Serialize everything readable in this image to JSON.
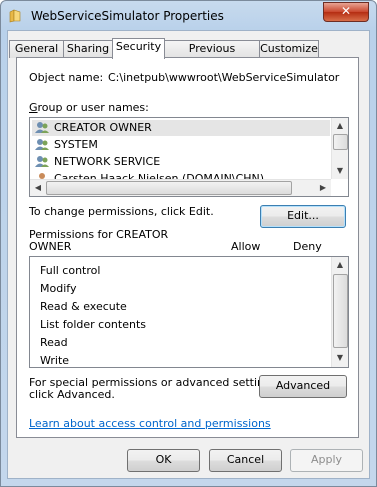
{
  "window": {
    "title": "WebServiceSimulator Properties",
    "close_glyph": "✕"
  },
  "tabs": [
    {
      "label": "General"
    },
    {
      "label": "Sharing"
    },
    {
      "label": "Security"
    },
    {
      "label": "Previous Versions"
    },
    {
      "label": "Customize"
    }
  ],
  "security": {
    "object_name_label": "Object name:",
    "object_name_value": "C:\\inetpub\\wwwroot\\WebServiceSimulator",
    "group_label": "Group or user names:",
    "groups": [
      {
        "name": "CREATOR OWNER",
        "icon": "users-icon",
        "selected": true
      },
      {
        "name": "SYSTEM",
        "icon": "users-icon"
      },
      {
        "name": "NETWORK SERVICE",
        "icon": "users-icon"
      },
      {
        "name": "Carsten Haack Nielsen (DOMAIN\\CHN)",
        "icon": "user-icon"
      }
    ],
    "change_text": "To change permissions, click Edit.",
    "edit_button": "Edit...",
    "permissions_for_line1": "Permissions for CREATOR",
    "permissions_for_line2": "OWNER",
    "allow_header": "Allow",
    "deny_header": "Deny",
    "permissions": [
      {
        "name": "Full control"
      },
      {
        "name": "Modify"
      },
      {
        "name": "Read & execute"
      },
      {
        "name": "List folder contents"
      },
      {
        "name": "Read"
      },
      {
        "name": "Write"
      }
    ],
    "special_text_line1": "For special permissions or advanced settings,",
    "special_text_line2": "click Advanced.",
    "advanced_button": "Advanced",
    "learn_link": "Learn about access control and permissions"
  },
  "footer": {
    "ok": "OK",
    "cancel": "Cancel",
    "apply": "Apply"
  },
  "colors": {
    "title_bar": "#b9d1ea",
    "close_button": "#c9462c",
    "link": "#0066cc"
  }
}
